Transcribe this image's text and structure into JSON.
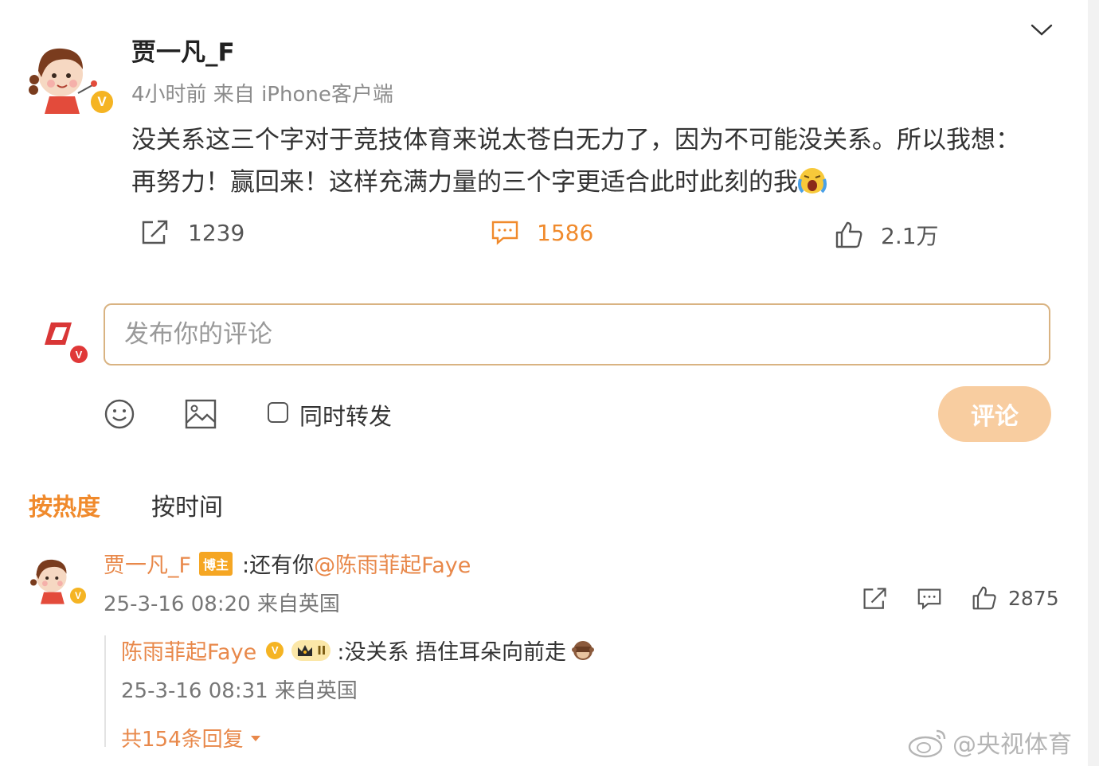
{
  "post": {
    "author": "贾一凡_F",
    "meta": "4小时前 来自 iPhone客户端",
    "text_line1": "没关系这三个字对于竞技体育来说太苍白无力了，因为不可能没关系。所以我想：",
    "text_line2": "再努力！赢回来！这样充满力量的三个字更适合此时此刻的我",
    "reposts": "1239",
    "comments": "1586",
    "likes": "2.1万"
  },
  "composer": {
    "placeholder": "发布你的评论",
    "repost_label": "同时转发",
    "submit_label": "评论"
  },
  "sort": {
    "hot": "按热度",
    "time": "按时间"
  },
  "comment": {
    "author": "贾一凡_F",
    "badge": "博主",
    "text_prefix": ":还有你",
    "mention": "@陈雨菲起Faye",
    "meta": "25-3-16 08:20 来自英国",
    "likes": "2875"
  },
  "reply": {
    "author": "陈雨菲起Faye",
    "level": "II",
    "text": ":没关系 捂住耳朵向前走",
    "meta": "25-3-16 08:31 来自英国",
    "more": "共154条回复"
  },
  "watermark": "@央视体育",
  "colors": {
    "accent": "#f08a2c",
    "name": "#e8884a",
    "vip": "#f5b423",
    "submit_disabled": "#f8cda0"
  }
}
